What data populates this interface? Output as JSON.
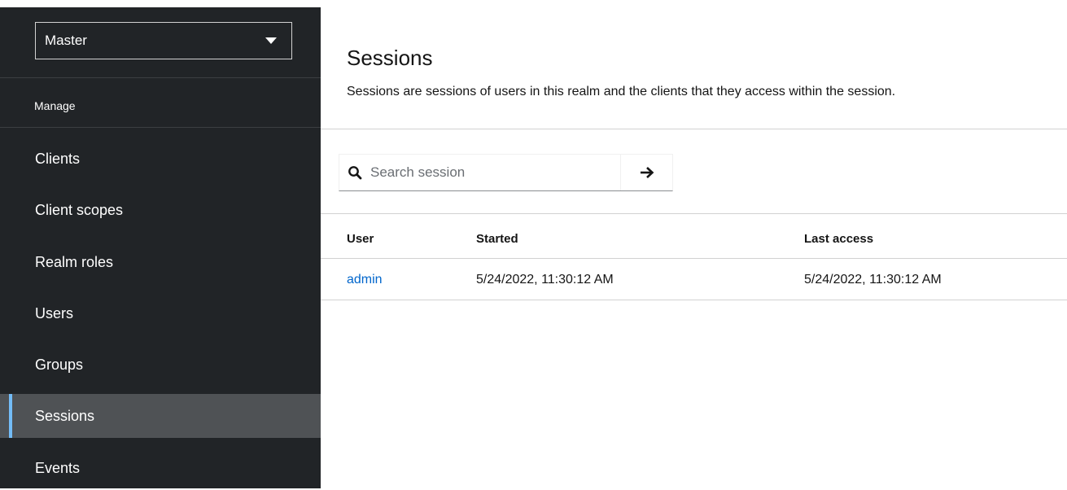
{
  "sidebar": {
    "realm": "Master",
    "section_title": "Manage",
    "items": [
      {
        "label": "Clients"
      },
      {
        "label": "Client scopes"
      },
      {
        "label": "Realm roles"
      },
      {
        "label": "Users"
      },
      {
        "label": "Groups"
      },
      {
        "label": "Sessions",
        "active": true
      },
      {
        "label": "Events"
      }
    ]
  },
  "main": {
    "title": "Sessions",
    "description": "Sessions are sessions of users in this realm and the clients that they access within the session.",
    "search": {
      "placeholder": "Search session",
      "value": "",
      "icon": "search-icon",
      "button_icon": "arrow-right-icon"
    },
    "table": {
      "columns": [
        "User",
        "Started",
        "Last access"
      ],
      "rows": [
        {
          "user": "admin",
          "started": "5/24/2022, 11:30:12 AM",
          "last_access": "5/24/2022, 11:30:12 AM"
        }
      ]
    }
  },
  "colors": {
    "sidebar_bg": "#212427",
    "active_bg": "#4f5255",
    "active_indicator": "#73bcf7",
    "link": "#0066cc"
  }
}
